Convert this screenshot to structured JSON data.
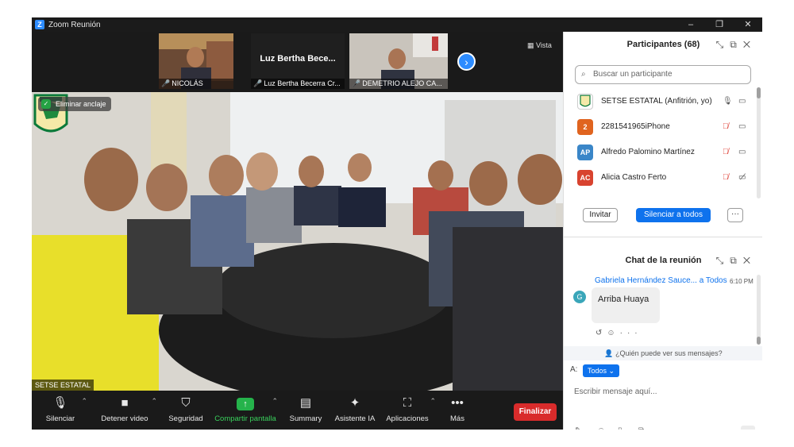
{
  "window": {
    "app_icon": "Z",
    "title": "Zoom Reunión",
    "controls": [
      "‒",
      "❐",
      "✕"
    ]
  },
  "strip": {
    "tiles": [
      {
        "name": "NICOLÁS"
      },
      {
        "name": "Luz Bertha Becerra Cr...",
        "display_name": "Luz Bertha Bece..."
      },
      {
        "name": "DEMETRIO ALEJO CA..."
      }
    ],
    "next_icon": "chevron-right-icon",
    "view_label": "Vista"
  },
  "main_video": {
    "label": "SETSE ESTATAL",
    "unpin_label": "Eliminar anclaje"
  },
  "toolbar": {
    "mute": "Silenciar",
    "video": "Detener video",
    "security": "Seguridad",
    "share": "Compartir pantalla",
    "summary": "Summary",
    "ai": "Asistente IA",
    "apps": "Aplicaciones",
    "more": "Más",
    "end": "Finalizar",
    "share_color": "#25b34b",
    "end_color": "#d92b2b"
  },
  "participants": {
    "title": "Participantes (68)",
    "search_placeholder": "Buscar un participante",
    "list": [
      {
        "initials": "",
        "name": "SETSE ESTATAL (Anfitrión, yo)",
        "color": "#ffffff",
        "mic": "on",
        "cam": "on"
      },
      {
        "initials": "2",
        "name": "2281541965iPhone",
        "color": "#e0641f",
        "mic": "muted",
        "cam": "on"
      },
      {
        "initials": "AP",
        "name": "Alfredo Palomino Martínez",
        "color": "#3a86c8",
        "mic": "muted",
        "cam": "on"
      },
      {
        "initials": "AC",
        "name": "Alicia Castro Ferto",
        "color": "#d8432f",
        "mic": "muted",
        "cam": "off"
      }
    ],
    "invite": "Invitar",
    "mute_all": "Silenciar a todos",
    "more": "···"
  },
  "chat": {
    "title": "Chat de la reunión",
    "sender": "Gabriela Hernández Sauce...",
    "to": "a Todos",
    "time": "6:10 PM",
    "avatar": "G",
    "message": "Arriba Huaya",
    "who_can_see": "¿Quién puede ver sus mensajes?",
    "to_label": "A:",
    "to_value": "Todos",
    "input_placeholder": "Escribir mensaje aquí..."
  },
  "colors": {
    "accent": "#0e72ed",
    "muted_red": "#e0463c"
  }
}
